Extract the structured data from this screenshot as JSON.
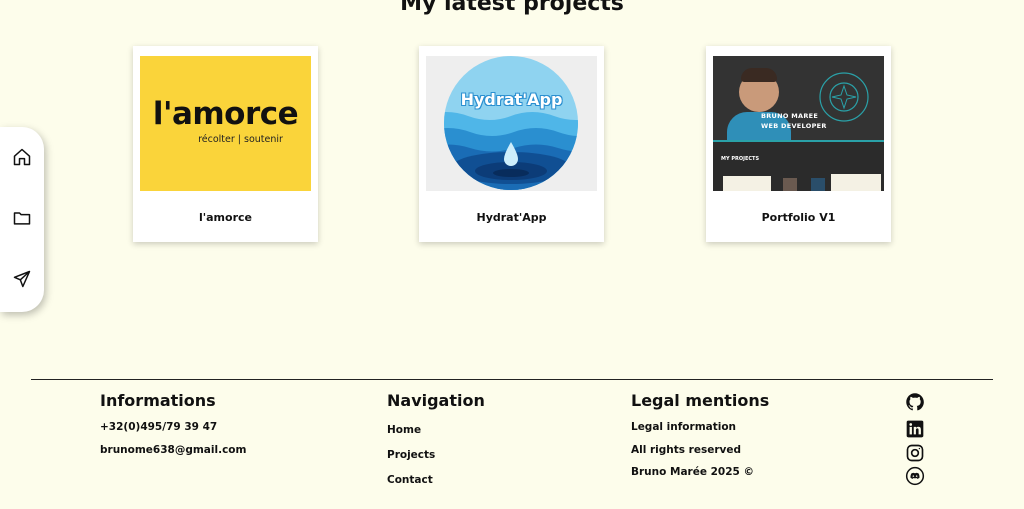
{
  "section": {
    "title": "My latest projects"
  },
  "projects": [
    {
      "title": "l'amorce",
      "logo_text": "l'amorce",
      "logo_sub": "récolter | soutenir"
    },
    {
      "title": "Hydrat'App",
      "logo_text": "Hydrat'App"
    },
    {
      "title": "Portfolio V1",
      "hero_line1": "BRUNO MAREE",
      "hero_line2": "WEB DEVELOPER",
      "projects_label": "MY PROJECTS"
    }
  ],
  "side_nav": {
    "icons": [
      "home-icon",
      "folder-icon",
      "send-icon"
    ]
  },
  "footer": {
    "informations": {
      "heading": "Informations",
      "phone": "+32(0)495/79 39 47",
      "email": "brunome638@gmail.com"
    },
    "navigation": {
      "heading": "Navigation",
      "links": [
        "Home",
        "Projects",
        "Contact"
      ]
    },
    "legal": {
      "heading": "Legal mentions",
      "items": [
        "Legal information",
        "All rights reserved",
        "Bruno Marée 2025 ©"
      ]
    },
    "social_icons": [
      "github-icon",
      "linkedin-icon",
      "instagram-icon",
      "discord-icon"
    ]
  },
  "colors": {
    "background": "#fdfdeb",
    "amorce_yellow": "#fad43a",
    "dark": "#111111"
  }
}
